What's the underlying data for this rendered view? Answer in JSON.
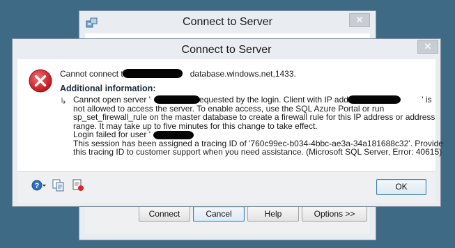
{
  "background_window": {
    "title": "Connect to Server",
    "close_glyph": "✕",
    "buttons": {
      "connect": "Connect",
      "cancel": "Cancel",
      "help": "Help",
      "options": "Options >>"
    }
  },
  "error_dialog": {
    "title": "Connect to Server",
    "close_glyph": "✕",
    "error_icon": "error-icon",
    "message_prefix": "Cannot connect to ",
    "message_suffix": "database.windows.net,1433.",
    "additional_info_heading": "Additional information:",
    "arrow_glyph": "↳",
    "details": {
      "line1_a": "Cannot open server '",
      "line1_b": "requested by the login. Client with IP address '",
      "line1_c": "' is",
      "line2": "not allowed to access the server.  To enable access, use the SQL Azure Portal or run",
      "line3": "sp_set_firewall_rule on the master database to create a firewall rule for this IP address or address",
      "line4": "range.  It may take up to five minutes for this change to take effect.",
      "line5_a": "Login failed for user '",
      "line6": "This session has been assigned a tracing ID of '760c99ec-b034-4bbc-ae3a-34a181688c32'.  Provide",
      "line7": "this tracing ID to customer support when you need assistance. (Microsoft SQL Server, Error: 40615)"
    },
    "toolbar_icons": [
      "help-icon",
      "copy-icon",
      "show-details-icon"
    ],
    "ok_label": "OK"
  },
  "colors": {
    "desktop": "#3f6a86",
    "chrome": "#e9edf1",
    "error_red": "#d8262c",
    "default_button_border": "#3c7fb1"
  }
}
